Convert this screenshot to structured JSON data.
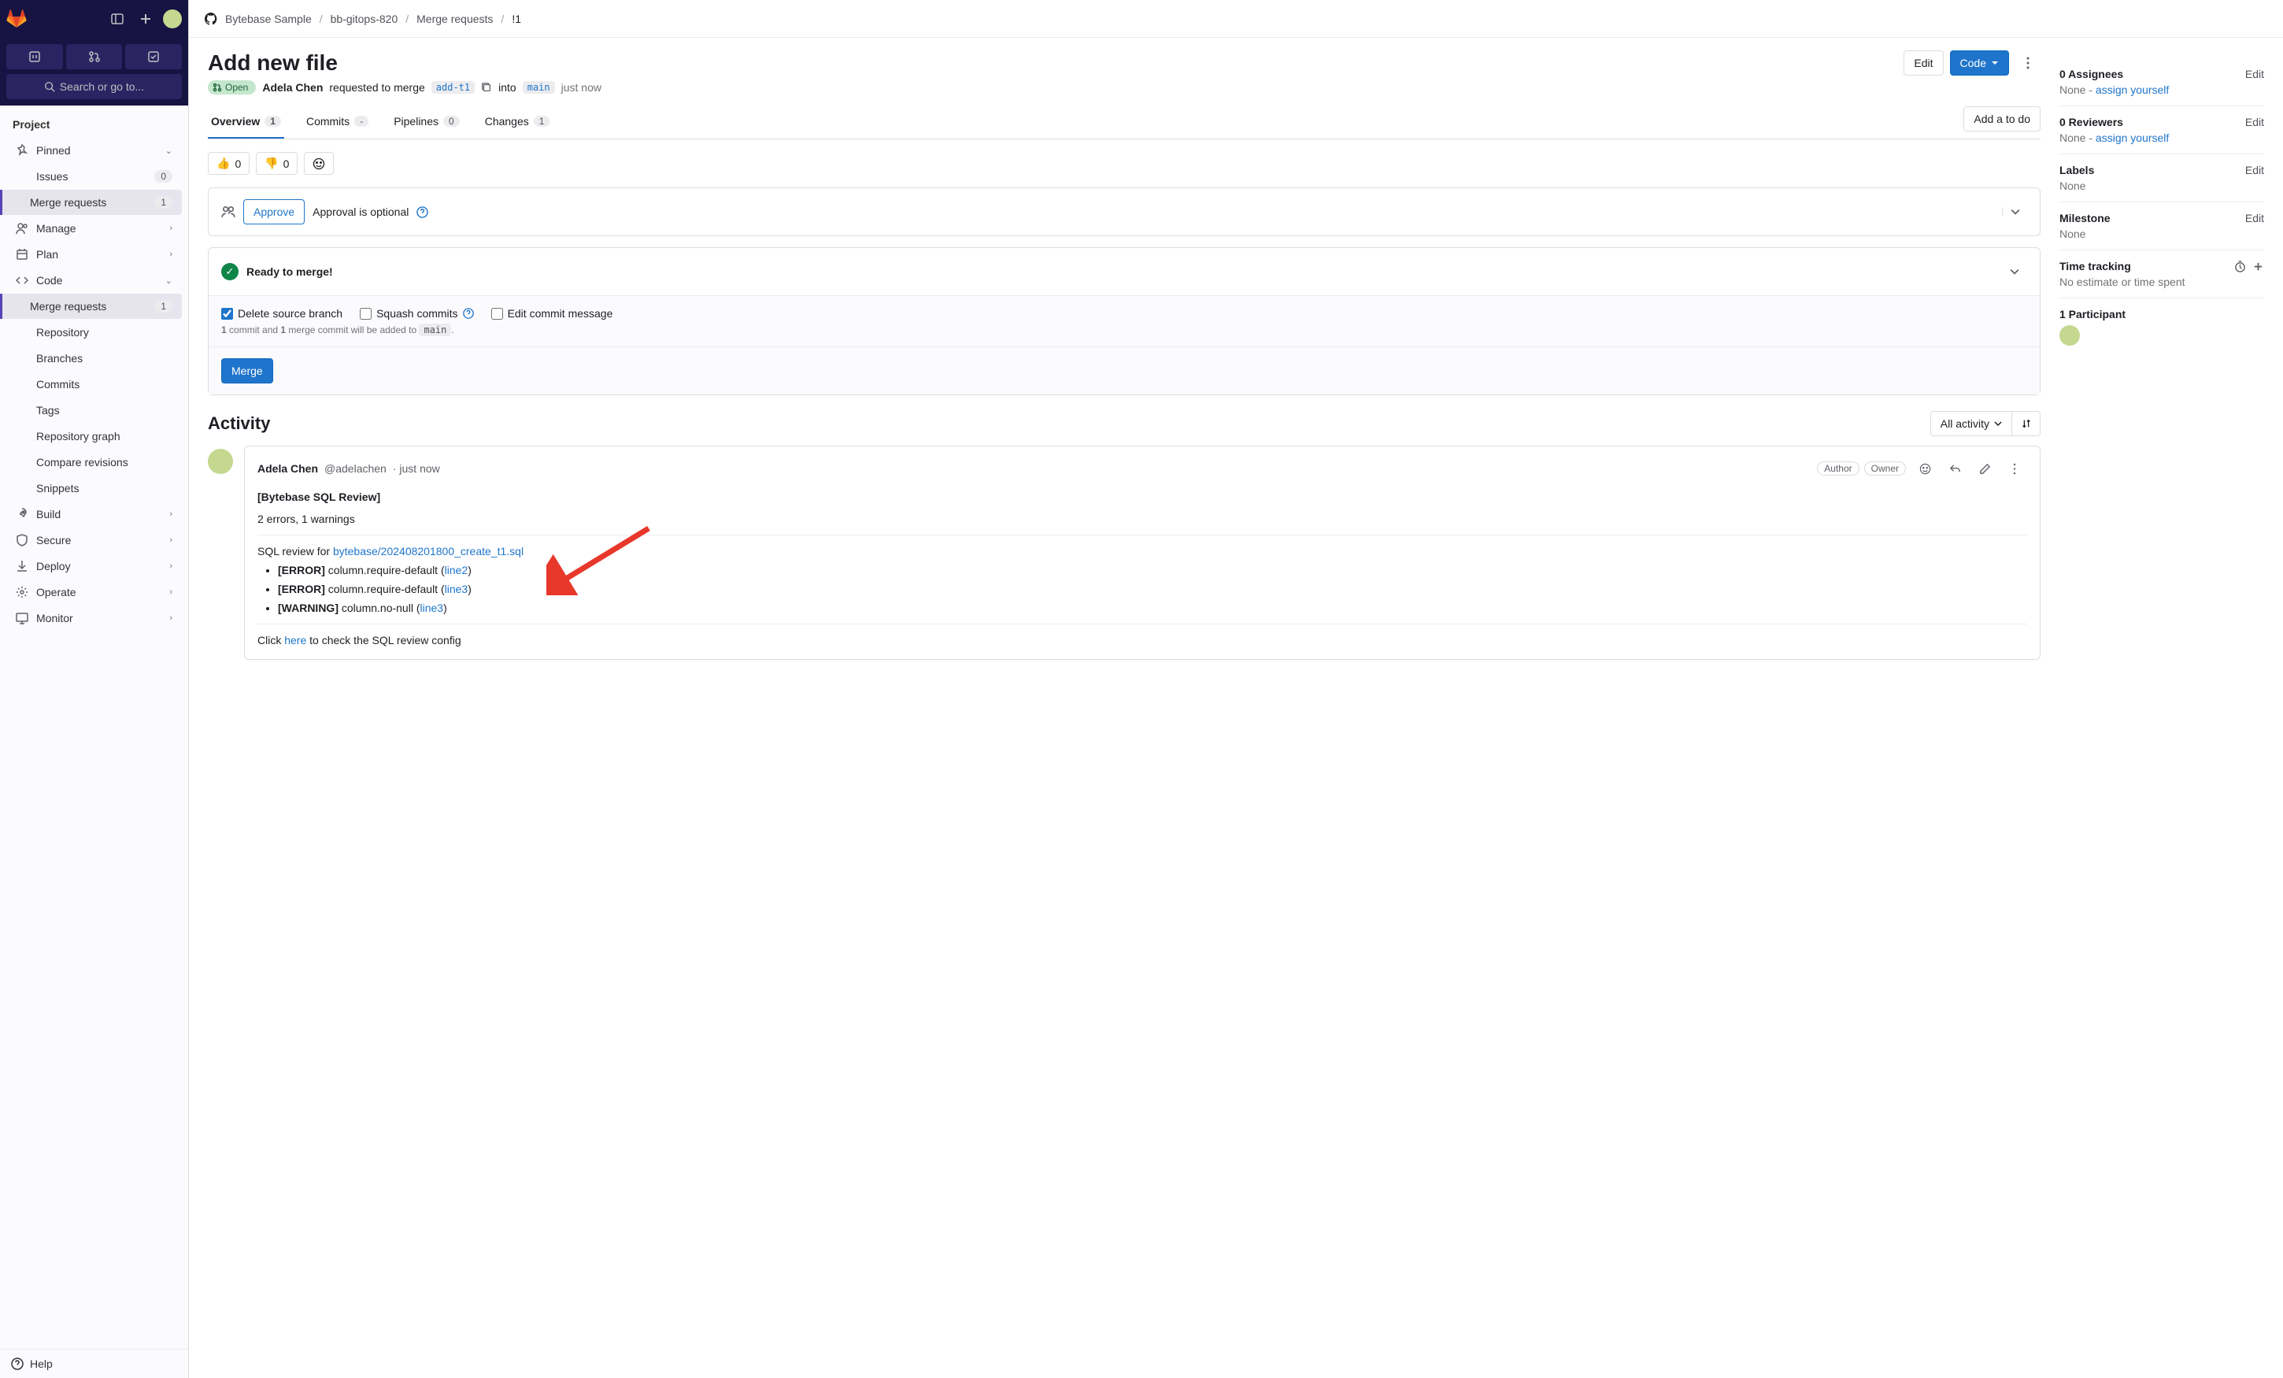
{
  "topbar": {
    "search_placeholder": "Search or go to..."
  },
  "sidebar": {
    "project_label": "Project",
    "pinned_label": "Pinned",
    "help_label": "Help",
    "pinned_items": [
      {
        "label": "Issues",
        "badge": "0"
      },
      {
        "label": "Merge requests",
        "badge": "1"
      }
    ],
    "groups": [
      {
        "label": "Manage",
        "expandable": true
      },
      {
        "label": "Plan",
        "expandable": true
      },
      {
        "label": "Code",
        "expandable": true,
        "expanded": true,
        "children": [
          {
            "label": "Merge requests",
            "badge": "1",
            "active": true
          },
          {
            "label": "Repository"
          },
          {
            "label": "Branches"
          },
          {
            "label": "Commits"
          },
          {
            "label": "Tags"
          },
          {
            "label": "Repository graph"
          },
          {
            "label": "Compare revisions"
          },
          {
            "label": "Snippets"
          }
        ]
      },
      {
        "label": "Build",
        "expandable": true
      },
      {
        "label": "Secure",
        "expandable": true
      },
      {
        "label": "Deploy",
        "expandable": true
      },
      {
        "label": "Operate",
        "expandable": true
      },
      {
        "label": "Monitor",
        "expandable": true
      }
    ]
  },
  "breadcrumbs": {
    "items": [
      "Bytebase Sample",
      "bb-gitops-820",
      "Merge requests"
    ],
    "current": "!1"
  },
  "header": {
    "title": "Add new file",
    "edit_label": "Edit",
    "code_label": "Code"
  },
  "meta": {
    "status": "Open",
    "author": "Adela Chen",
    "action_text": "requested to merge",
    "src_branch": "add-t1",
    "into_label": "into",
    "dst_branch": "main",
    "time": "just now"
  },
  "tabs": [
    {
      "label": "Overview",
      "count": "1",
      "active": true
    },
    {
      "label": "Commits",
      "count": "-"
    },
    {
      "label": "Pipelines",
      "count": "0"
    },
    {
      "label": "Changes",
      "count": "1"
    }
  ],
  "tabs_action": "Add a to do",
  "reactions": {
    "thumbs_up": "0",
    "thumbs_down": "0"
  },
  "approval": {
    "approve_label": "Approve",
    "optional_text": "Approval is optional"
  },
  "merge": {
    "ready_label": "Ready to merge!",
    "delete_branch_label": "Delete source branch",
    "squash_label": "Squash commits",
    "edit_msg_label": "Edit commit message",
    "hint_prefix": "1",
    "hint_mid1": " commit and ",
    "hint_mid2": "1",
    "hint_mid3": " merge commit will be added to ",
    "hint_branch": "main",
    "hint_suffix": ".",
    "merge_btn": "Merge"
  },
  "activity": {
    "heading": "Activity",
    "filter_label": "All activity"
  },
  "note": {
    "author": "Adela Chen",
    "handle": "@adelachen",
    "sep": " · ",
    "time": "just now",
    "badge_author": "Author",
    "badge_owner": "Owner",
    "title": "[Bytebase SQL Review]",
    "summary": "2 errors, 1 warnings",
    "review_prefix": "SQL review for ",
    "review_file": "bytebase/202408201800_create_t1.sql",
    "issues": [
      {
        "tag": "[ERROR]",
        "rule": " column.require-default (",
        "line_label": "line2",
        "suffix": ")"
      },
      {
        "tag": "[ERROR]",
        "rule": " column.require-default (",
        "line_label": "line3",
        "suffix": ")"
      },
      {
        "tag": "[WARNING]",
        "rule": " column.no-null (",
        "line_label": "line3",
        "suffix": ")"
      }
    ],
    "footer_prefix": "Click ",
    "footer_link": "here",
    "footer_suffix": " to check the SQL review config"
  },
  "side": {
    "sections": [
      {
        "label": "0 Assignees",
        "value_pre": "None - ",
        "value_link": "assign yourself",
        "edit": "Edit"
      },
      {
        "label": "0 Reviewers",
        "value_pre": "None - ",
        "value_link": "assign yourself",
        "edit": "Edit"
      },
      {
        "label": "Labels",
        "value": "None",
        "edit": "Edit"
      },
      {
        "label": "Milestone",
        "value": "None",
        "edit": "Edit"
      }
    ],
    "time_tracking": {
      "label": "Time tracking",
      "value": "No estimate or time spent"
    },
    "participant": {
      "label": "1 Participant"
    }
  }
}
